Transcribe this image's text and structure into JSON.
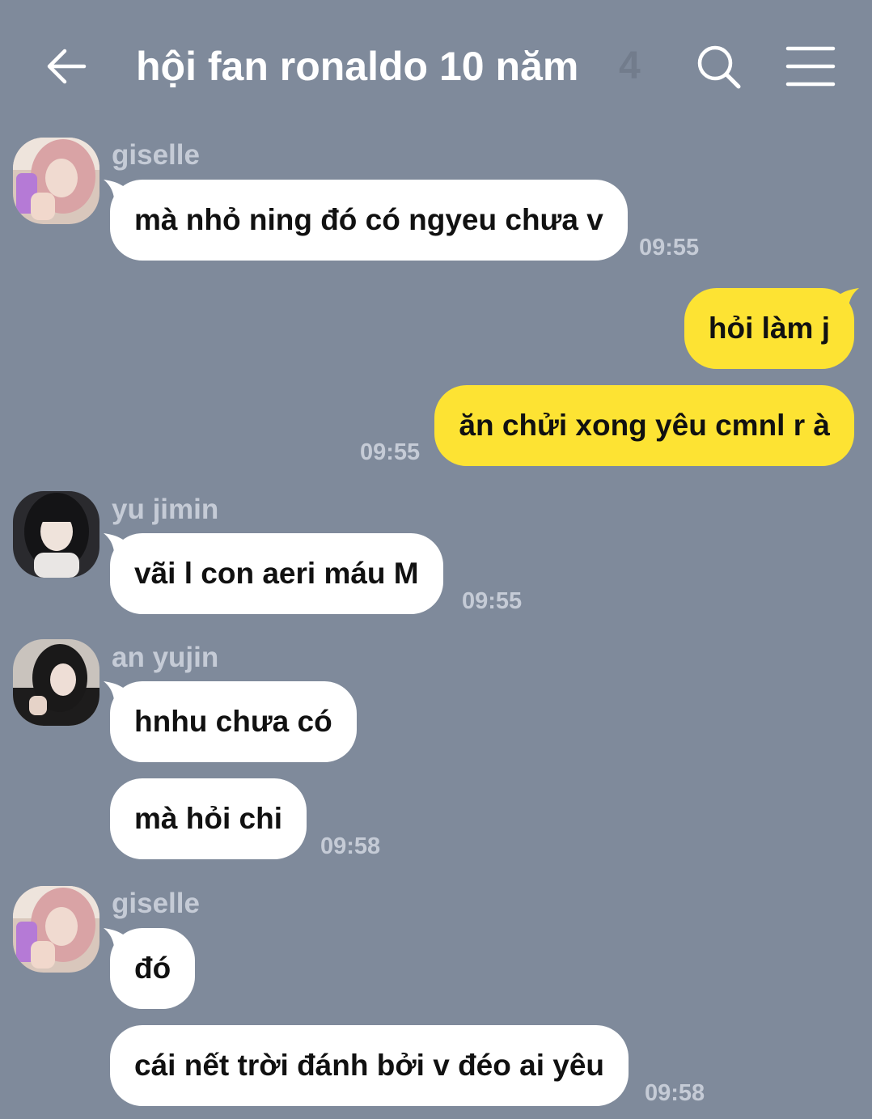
{
  "header": {
    "title": "hội fan ronaldo 10 năm",
    "member_count": "4",
    "back_icon": "arrow-left-icon",
    "search_icon": "search-icon",
    "menu_icon": "menu-icon"
  },
  "colors": {
    "background": "#7f8a9b",
    "incoming_bubble": "#ffffff",
    "outgoing_bubble": "#fde333",
    "meta_text": "#c5cbd6"
  },
  "messages": [
    {
      "sender": "giselle",
      "text": "mà nhỏ ning đó có ngyeu chưa v",
      "time": "09:55",
      "direction": "incoming"
    },
    {
      "text": "hỏi làm j",
      "direction": "outgoing"
    },
    {
      "text": "ăn chửi xong yêu cmnl r à",
      "time": "09:55",
      "direction": "outgoing"
    },
    {
      "sender": "yu jimin",
      "text": "vãi l con aeri máu M",
      "time": "09:55",
      "direction": "incoming"
    },
    {
      "sender": "an yujin",
      "text": "hnhu chưa có",
      "direction": "incoming"
    },
    {
      "text": "mà hỏi chi",
      "time": "09:58",
      "direction": "incoming"
    },
    {
      "sender": "giselle",
      "text": "đó",
      "direction": "incoming"
    },
    {
      "text": "cái nết trời đánh bởi v đéo ai yêu",
      "time": "09:58",
      "direction": "incoming"
    }
  ]
}
